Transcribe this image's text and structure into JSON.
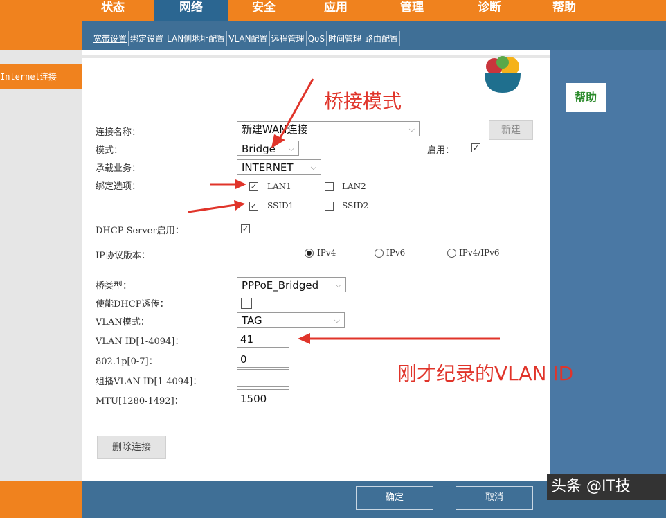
{
  "top_nav": {
    "tabs": [
      {
        "label": "状态",
        "active": false
      },
      {
        "label": "网络",
        "active": true
      },
      {
        "label": "安全",
        "active": false
      },
      {
        "label": "应用",
        "active": false
      },
      {
        "label": "管理",
        "active": false
      },
      {
        "label": "诊断",
        "active": false
      },
      {
        "label": "帮助",
        "active": false
      }
    ]
  },
  "sub_nav": {
    "items": [
      "宽带设置",
      "绑定设置",
      "LAN侧地址配置",
      "VLAN配置",
      "远程管理",
      "QoS",
      "时间管理",
      "路由配置"
    ]
  },
  "left_nav": {
    "active_item": "Internet连接"
  },
  "form": {
    "connection_name_label": "连接名称：",
    "connection_name_value": "新建WAN连接",
    "new_button": "新建",
    "mode_label": "模式：",
    "mode_value": "Bridge",
    "enable_label": "启用：",
    "enable_checked": true,
    "service_label": "承载业务：",
    "service_value": "INTERNET",
    "bind_label": "绑定选项：",
    "bind_options": [
      {
        "label": "LAN1",
        "checked": true
      },
      {
        "label": "LAN2",
        "checked": false
      },
      {
        "label": "SSID1",
        "checked": true
      },
      {
        "label": "SSID2",
        "checked": false
      }
    ],
    "dhcp_server_label": "DHCP Server启用：",
    "dhcp_server_checked": true,
    "ip_version_label": "IP协议版本：",
    "ip_versions": [
      {
        "label": "IPv4",
        "selected": true
      },
      {
        "label": "IPv6",
        "selected": false
      },
      {
        "label": "IPv4/IPv6",
        "selected": false
      }
    ],
    "bridge_type_label": "桥类型：",
    "bridge_type_value": "PPPoE_Bridged",
    "dhcp_passthrough_label": "使能DHCP透传：",
    "dhcp_passthrough_checked": false,
    "vlan_mode_label": "VLAN模式：",
    "vlan_mode_value": "TAG",
    "vlan_id_label": "VLAN ID[1-4094]：",
    "vlan_id_value": "41",
    "dot1p_label": "802.1p[0-7]：",
    "dot1p_value": "0",
    "multicast_vlan_label": "组播VLAN ID[1-4094]：",
    "multicast_vlan_value": "",
    "mtu_label": "MTU[1280-1492]：",
    "mtu_value": "1500",
    "delete_button": "删除连接"
  },
  "help": {
    "label": "帮助"
  },
  "footer": {
    "ok_label": "确定",
    "cancel_label": "取消"
  },
  "annotations": {
    "bridge_mode": "桥接模式",
    "vlan_note": "刚才纪录的VLAN ID"
  },
  "watermark": {
    "text": "头条 @IT技"
  },
  "colors": {
    "orange": "#f0821e",
    "blue": "#3f6f96",
    "annotation_red": "#e0342a"
  }
}
